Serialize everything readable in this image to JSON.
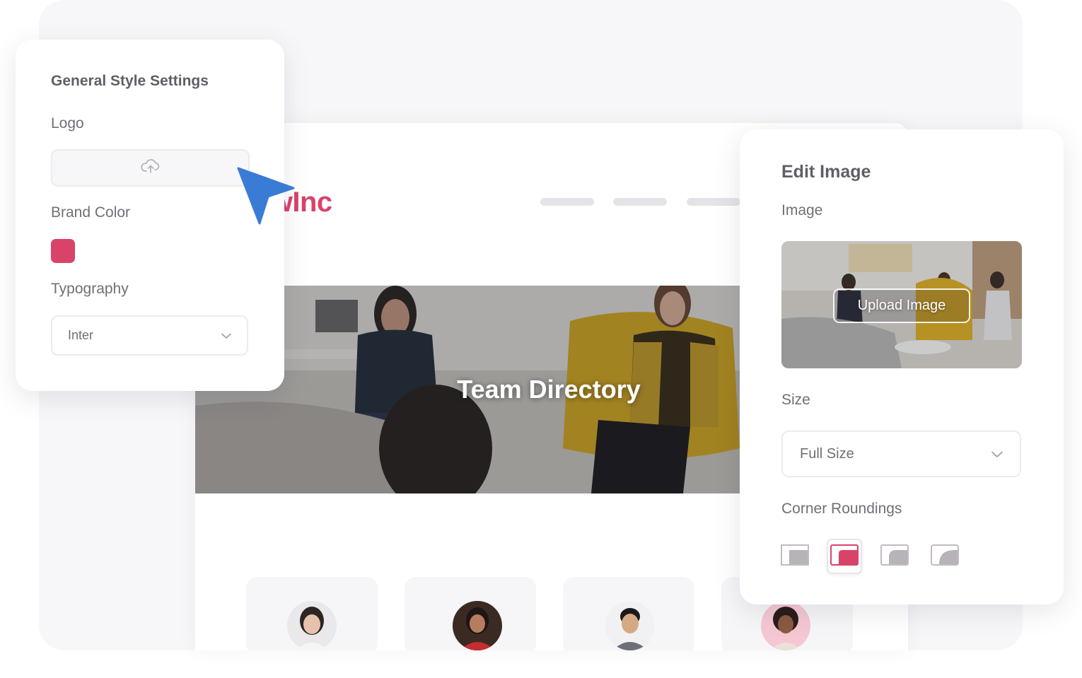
{
  "colors": {
    "brand": "#d9436a",
    "panel_text": "#5f5f68",
    "label_text": "#6f6f78",
    "icon_gray": "#b8b3b8",
    "page_bg": "#f7f7f9"
  },
  "site": {
    "logo_text": "ewInc",
    "hero_title": "Team Directory",
    "nav_items": 3,
    "team_cards": 4
  },
  "general_settings": {
    "title": "General Style Settings",
    "logo_label": "Logo",
    "logo_upload_icon": "cloud-upload-icon",
    "brand_color_label": "Brand Color",
    "brand_color_value": "#d9436a",
    "typography_label": "Typography",
    "font_select_value": "Inter",
    "font_select_icon": "chevron-down-icon"
  },
  "edit_image": {
    "title": "Edit Image",
    "image_label": "Image",
    "upload_button": "Upload Image",
    "size_label": "Size",
    "size_select_value": "Full Size",
    "corner_label": "Corner Roundings",
    "corner_options": [
      {
        "name": "none",
        "selected": false
      },
      {
        "name": "small",
        "selected": true
      },
      {
        "name": "medium",
        "selected": false
      },
      {
        "name": "large",
        "selected": false
      }
    ]
  },
  "cursor_icon": "pointer-arrow-icon"
}
